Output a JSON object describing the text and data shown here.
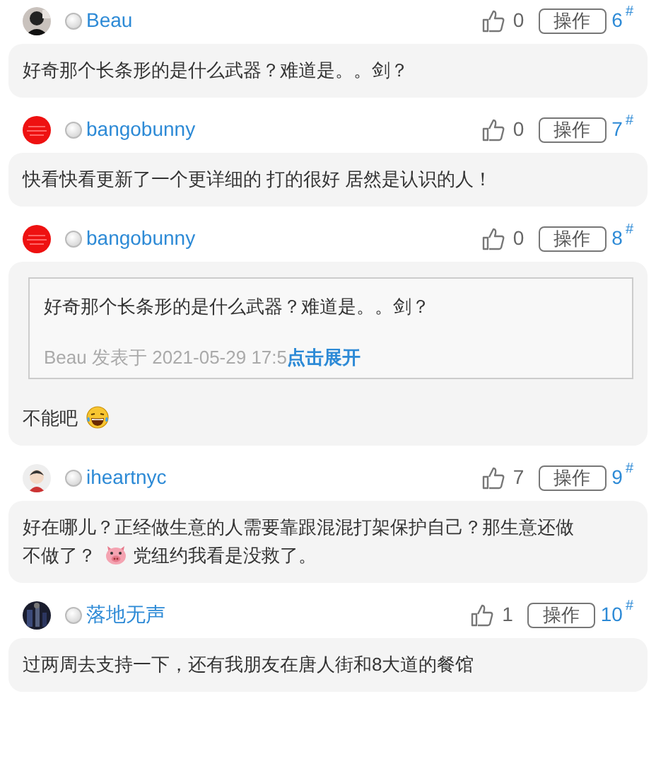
{
  "comments": [
    {
      "user": "Beau",
      "online": false,
      "likes": "0",
      "action": "操作",
      "floor": "6",
      "floor_mark": "#",
      "body": [
        {
          "kind": "text",
          "text": "好奇那个长条形的是什么武器？难道是。。剑？"
        }
      ]
    },
    {
      "user": "bangobunny",
      "online": false,
      "likes": "0",
      "action": "操作",
      "floor": "7",
      "floor_mark": "#",
      "body": [
        {
          "kind": "text",
          "text": "快看快看更新了一个更详细的 打的很好 居然是认识的人！"
        }
      ]
    },
    {
      "user": "bangobunny",
      "online": false,
      "likes": "0",
      "action": "操作",
      "floor": "8",
      "floor_mark": "#",
      "quote": {
        "text": "好奇那个长条形的是什么武器？难道是。。剑？",
        "meta": "Beau 发表于 2021-05-29 17:5",
        "expand": "点击展开"
      },
      "body": [
        {
          "kind": "text",
          "text": "不能吧"
        },
        {
          "kind": "laugh-emoji"
        }
      ]
    },
    {
      "user": "iheartnyc",
      "online": false,
      "likes": "7",
      "action": "操作",
      "floor": "9",
      "floor_mark": "#",
      "body": [
        {
          "kind": "text",
          "text": "好在哪儿？正经做生意的人需要靠跟混混打架保护自己？那生意还做"
        },
        {
          "kind": "break"
        },
        {
          "kind": "text",
          "text": "不做了？"
        },
        {
          "kind": "pig-emoji"
        },
        {
          "kind": "text",
          "text": "党纽约我看是没救了。"
        }
      ]
    },
    {
      "user": "落地无声",
      "online": false,
      "likes": "1",
      "action": "操作",
      "floor": "10",
      "floor_mark": "#",
      "body": [
        {
          "kind": "text",
          "text": "过两周去支持一下，还有我朋友在唐人街和8大道的餐馆"
        }
      ]
    }
  ]
}
